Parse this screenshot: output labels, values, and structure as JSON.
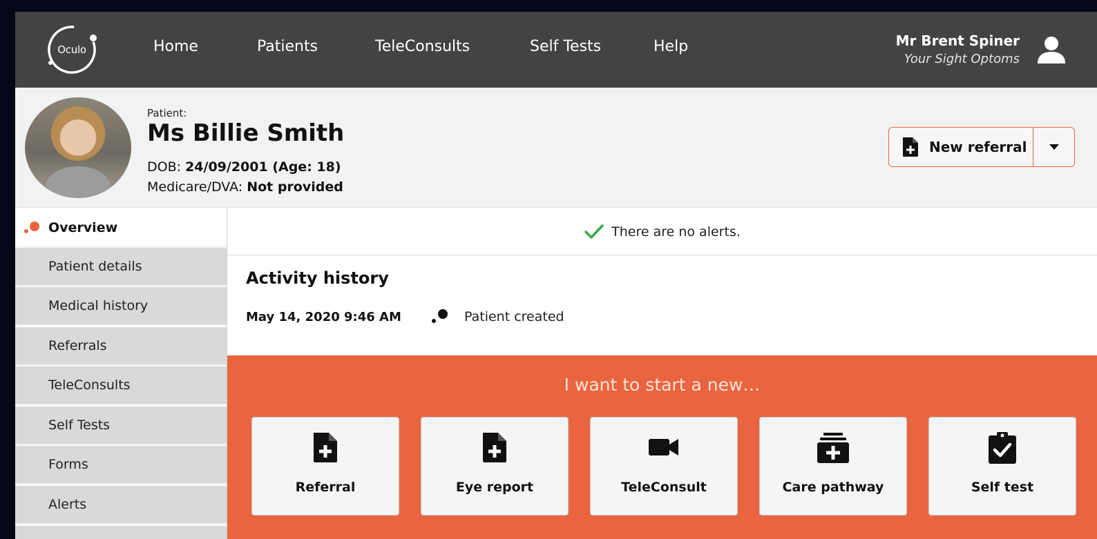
{
  "brand": {
    "logo_text": "Oculo",
    "accent": "#e8653f",
    "nav_bg": "#434343"
  },
  "nav": {
    "links": [
      "Home",
      "Patients",
      "TeleConsults",
      "Self Tests",
      "Help"
    ]
  },
  "user": {
    "name": "Mr Brent Spiner",
    "org": "Your Sight Optoms",
    "icon": "user-icon"
  },
  "patient": {
    "label": "Patient:",
    "name": "Ms Billie Smith",
    "dob_label": "DOB: ",
    "dob_value": "24/09/2001 (Age: 18)",
    "medicare_label": "Medicare/DVA: ",
    "medicare_value": "Not provided"
  },
  "referral_button": {
    "label": "New referral",
    "icon": "file-plus-icon",
    "caret_icon": "caret-down-icon"
  },
  "sidebar": {
    "items": [
      {
        "label": "Overview",
        "active": true
      },
      {
        "label": "Patient details"
      },
      {
        "label": "Medical history"
      },
      {
        "label": "Referrals"
      },
      {
        "label": "TeleConsults"
      },
      {
        "label": "Self Tests"
      },
      {
        "label": "Forms"
      },
      {
        "label": "Alerts"
      }
    ]
  },
  "alerts": {
    "text": "There are no alerts.",
    "icon": "checkmark-icon",
    "icon_color": "#3aa845"
  },
  "activity": {
    "title": "Activity history",
    "entries": [
      {
        "date": "May 14, 2020  9:46 AM",
        "text": "Patient created"
      }
    ]
  },
  "start": {
    "title": "I want to start a new…",
    "cards": [
      {
        "label": "Referral",
        "icon": "file-plus-icon"
      },
      {
        "label": "Eye report",
        "icon": "file-plus-icon"
      },
      {
        "label": "TeleConsult",
        "icon": "video-camera-icon"
      },
      {
        "label": "Care pathway",
        "icon": "pathway-plus-icon"
      },
      {
        "label": "Self test",
        "icon": "clipboard-check-icon"
      }
    ]
  }
}
